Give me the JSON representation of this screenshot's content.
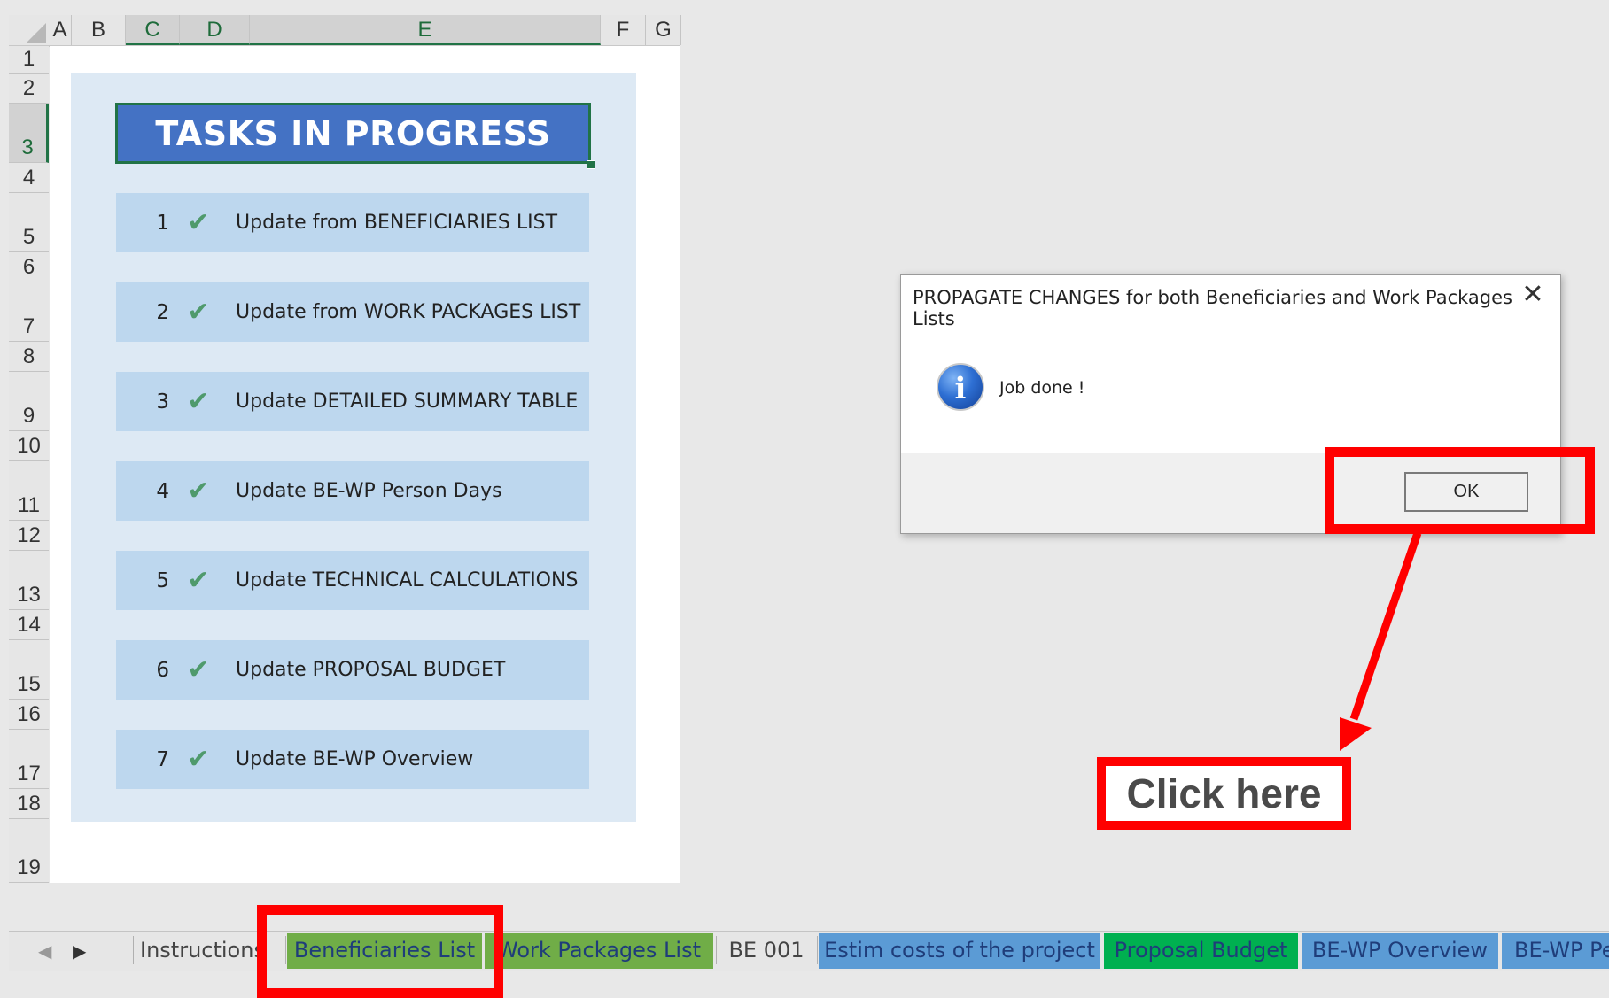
{
  "spreadsheet": {
    "columns": [
      "A",
      "B",
      "C",
      "D",
      "E",
      "F",
      "G"
    ],
    "rows": [
      "1",
      "2",
      "3",
      "4",
      "5",
      "6",
      "7",
      "8",
      "9",
      "10",
      "11",
      "12",
      "13",
      "14",
      "15",
      "16",
      "17",
      "18",
      "19"
    ],
    "title": "TASKS IN PROGRESS",
    "tasks": [
      {
        "num": "1",
        "check": "✔",
        "label": "Update from BENEFICIARIES LIST"
      },
      {
        "num": "2",
        "check": "✔",
        "label": "Update from WORK PACKAGES LIST"
      },
      {
        "num": "3",
        "check": "✔",
        "label": "Update DETAILED SUMMARY TABLE"
      },
      {
        "num": "4",
        "check": "✔",
        "label": "Update BE-WP Person Days"
      },
      {
        "num": "5",
        "check": "✔",
        "label": "Update TECHNICAL CALCULATIONS"
      },
      {
        "num": "6",
        "check": "✔",
        "label": "Update PROPOSAL BUDGET"
      },
      {
        "num": "7",
        "check": "✔",
        "label": "Update BE-WP Overview"
      }
    ]
  },
  "dialog": {
    "title": "PROPAGATE CHANGES for both Beneficiaries and Work Packages Lists",
    "close": "✕",
    "icon": "info-icon",
    "icon_glyph": "i",
    "message": "Job done !",
    "ok_label": "OK"
  },
  "annotation": {
    "label": "Click here",
    "color": "#ff0000"
  },
  "tabs": {
    "prev": "◀",
    "next": "▶",
    "items": [
      {
        "label": "Instructions",
        "bg": "#e6e6e6",
        "color": "#444444"
      },
      {
        "label": "Beneficiaries List",
        "bg": "#70ad47",
        "color": "#1f3d7a"
      },
      {
        "label": "Work Packages List",
        "bg": "#70ad47",
        "color": "#1f3d7a"
      },
      {
        "label": "BE 001",
        "bg": "#e6e6e6",
        "color": "#444444"
      },
      {
        "label": "Estim costs of the project",
        "bg": "#5b9bd5",
        "color": "#1f3d7a"
      },
      {
        "label": "Proposal Budget",
        "bg": "#00b050",
        "color": "#1f3d7a"
      },
      {
        "label": "BE-WP Overview",
        "bg": "#5b9bd5",
        "color": "#1f3d7a"
      },
      {
        "label": "BE-WP Person Days",
        "bg": "#5b9bd5",
        "color": "#1f3d7a"
      }
    ]
  }
}
